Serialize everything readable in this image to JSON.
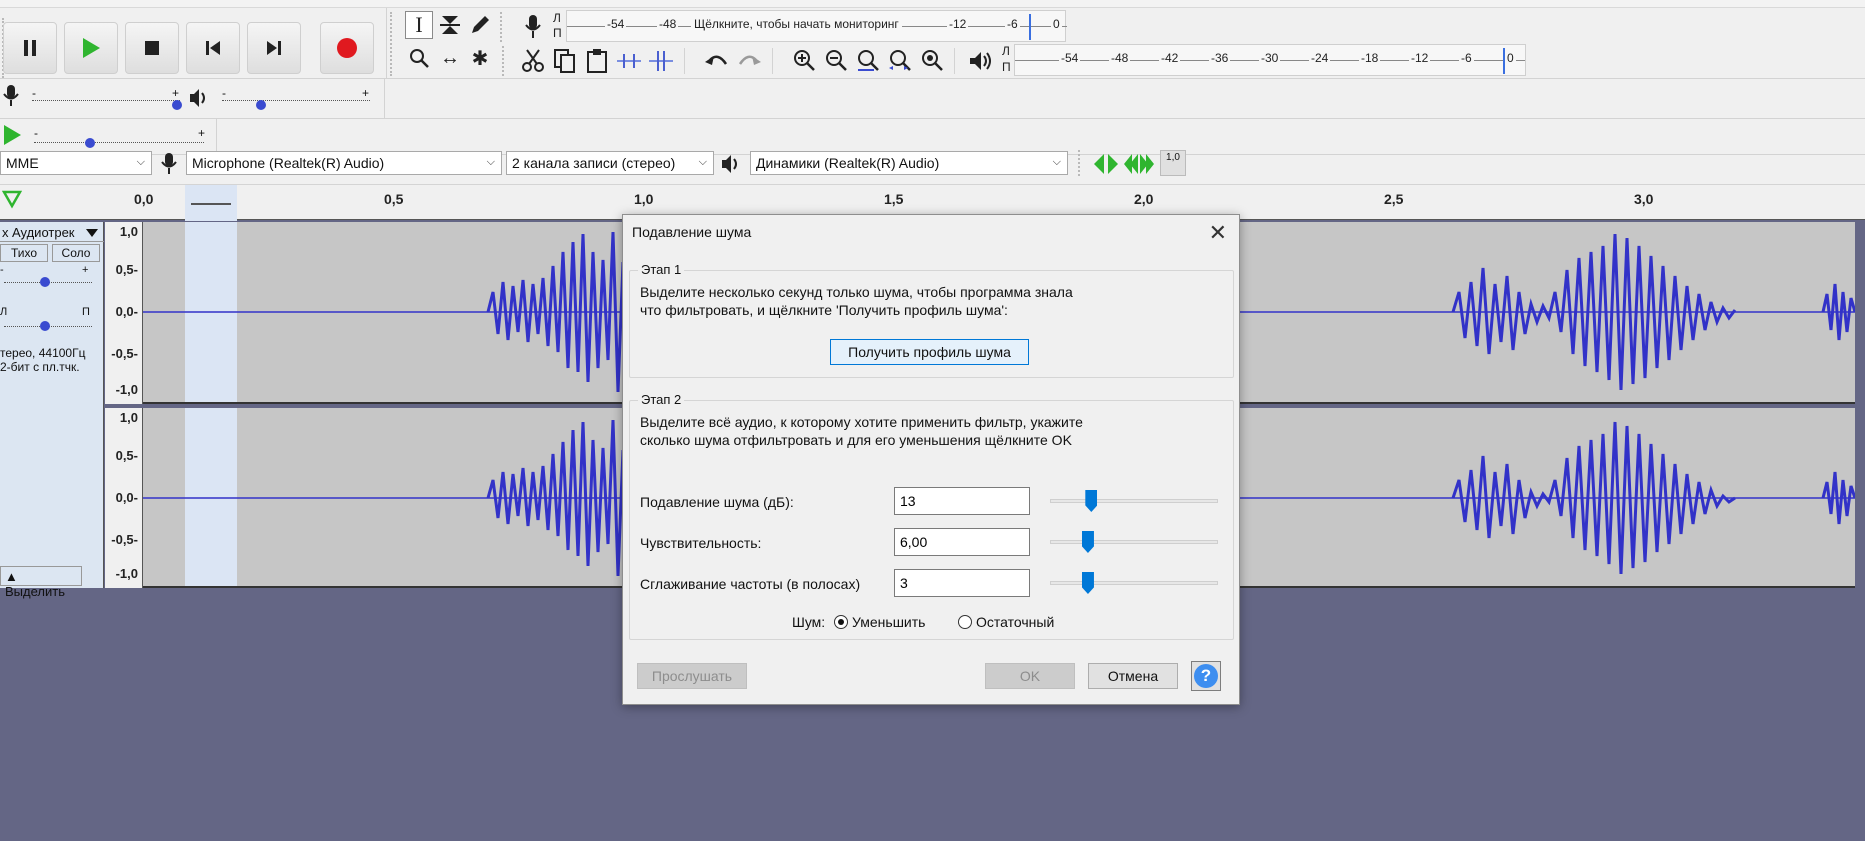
{
  "transport": {
    "pause_icon": "pause-icon",
    "play_icon": "play-icon",
    "stop_icon": "stop-icon",
    "skip_start_icon": "skip-to-start-icon",
    "skip_end_icon": "skip-to-end-icon",
    "record_icon": "record-icon",
    "colors": {
      "play": "#2fb52f",
      "record": "#e0191f"
    }
  },
  "tools": {
    "selection": "I",
    "envelope": "envelope-icon",
    "draw": "pencil-icon",
    "zoom": "zoom-icon",
    "timeshift": "↔",
    "multi": "✱"
  },
  "record_meter": {
    "l": "Л",
    "r": "П",
    "ticks": [
      "-54",
      "-48",
      "-12",
      "-6",
      "0"
    ],
    "hint": "Щёлкните, чтобы начать мониторинг"
  },
  "play_meter": {
    "l": "Л",
    "r": "П",
    "ticks": [
      "-54",
      "-48",
      "-42",
      "-36",
      "-30",
      "-24",
      "-18",
      "-12",
      "-6",
      "0"
    ]
  },
  "mixer": {
    "plus": "+",
    "minus": "-"
  },
  "devices": {
    "host": "MME",
    "mic": "Microphone (Realtek(R) Audio)",
    "channels": "2 канала записи (стерео)",
    "output": "Динамики (Realtek(R) Audio)",
    "rate_badge": "1,0"
  },
  "ruler": {
    "labels": [
      "0,0",
      "0,5",
      "1,0",
      "1,5",
      "2,0",
      "2,5",
      "3,0"
    ]
  },
  "track": {
    "name": "Аудиотрек",
    "close": "x",
    "mute": "Тихо",
    "solo": "Соло",
    "gain_minus": "-",
    "gain_plus": "+",
    "pan_l": "Л",
    "pan_r": "П",
    "info1": "тереo, 44100Гц",
    "info2": "2-бит с пл.тчк.",
    "select": "Выделить",
    "scale": [
      "1,0",
      "0,5-",
      "0,0-",
      "-0,5-",
      "-1,0"
    ],
    "scale2": [
      "1,0",
      "0,5-",
      "0,0-",
      "-0,5-",
      "-1,0"
    ],
    "wave_color": "#3232c8"
  },
  "dialog": {
    "title": "Подавление шума",
    "step1": {
      "legend": "Этап 1",
      "line1": "Выделите несколько секунд только шума, чтобы программа знала",
      "line2": "что фильтровать, и щёлкните 'Получить профиль шума':",
      "button": "Получить профиль шума"
    },
    "step2": {
      "legend": "Этап 2",
      "line1": "Выделите всё аудио, к которому хотите применить фильтр, укажите",
      "line2": "сколько шума отфильтровать и для его уменьшения щёлкните OK",
      "rows": [
        {
          "label": "Подавление шума (дБ):",
          "value": "13"
        },
        {
          "label": "Чувствительность:",
          "value": "6,00"
        },
        {
          "label": "Сглаживание частоты (в полосах)",
          "value": "3"
        }
      ],
      "slider_levels": [
        0.24,
        0.22,
        0.22
      ],
      "noise_label": "Шум:",
      "radio_reduce": "Уменьшить",
      "radio_residue": "Остаточный"
    },
    "preview": "Прослушать",
    "ok": "OK",
    "cancel": "Отмена",
    "help": "?"
  }
}
